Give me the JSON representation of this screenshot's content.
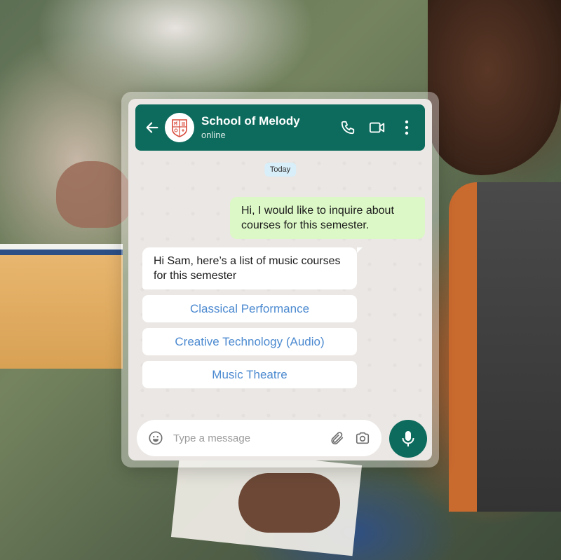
{
  "header": {
    "title": "School of Melody",
    "status": "online",
    "back_icon": "arrow-left-icon",
    "call_icon": "phone-icon",
    "video_icon": "video-camera-icon",
    "menu_icon": "more-vert-icon"
  },
  "date_chip": "Today",
  "messages": {
    "outgoing": "Hi, I would like to inquire about courses for this semester.",
    "incoming": "Hi Sam, here’s a list of music courses for this semester"
  },
  "options": [
    {
      "label": "Classical Performance"
    },
    {
      "label": "Creative Technology (Audio)"
    },
    {
      "label": "Music Theatre"
    }
  ],
  "input": {
    "placeholder": "Type a message",
    "value": ""
  },
  "colors": {
    "header_bg": "#0c6b5d",
    "outgoing_bubble": "#dcf8c6",
    "incoming_bubble": "#ffffff",
    "option_text": "#4c8ad0",
    "date_chip_bg": "#d8eef8"
  }
}
